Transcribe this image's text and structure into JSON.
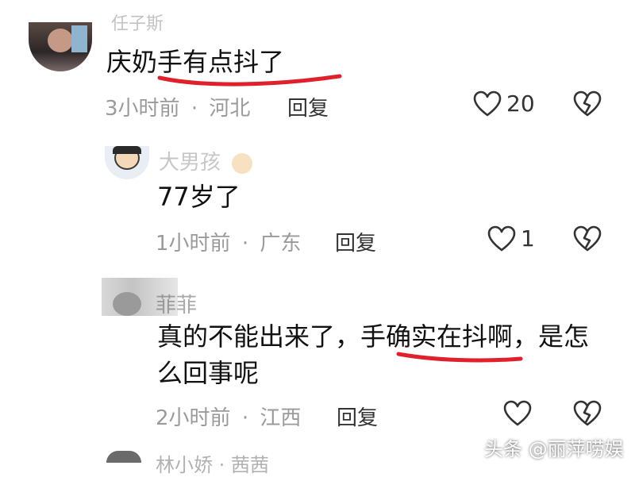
{
  "comments": [
    {
      "username": "任子斯",
      "text": "庆奶手有点抖了",
      "time": "3小时前",
      "separator": "·",
      "location": "河北",
      "reply_label": "回复",
      "likes": "20"
    },
    {
      "username": "大男孩",
      "text": "77岁了",
      "time": "1小时前",
      "separator": "·",
      "location": "广东",
      "reply_label": "回复",
      "likes": "1"
    },
    {
      "username": "菲菲",
      "text_line1_a": "真的不能出来了，手",
      "text_line1_b": "确实在抖啊",
      "text_line1_c": "，是怎",
      "text_line2": "么回事呢",
      "time": "2小时前",
      "separator": "·",
      "location": "江西",
      "reply_label": "回复"
    },
    {
      "username": "林小娇 · 茜茜"
    }
  ],
  "watermark": "头条 @丽萍唠娱",
  "colors": {
    "underline": "#e0202a",
    "meta": "#9a9a9a"
  },
  "icons": [
    "heart-icon",
    "broken-heart-icon"
  ]
}
